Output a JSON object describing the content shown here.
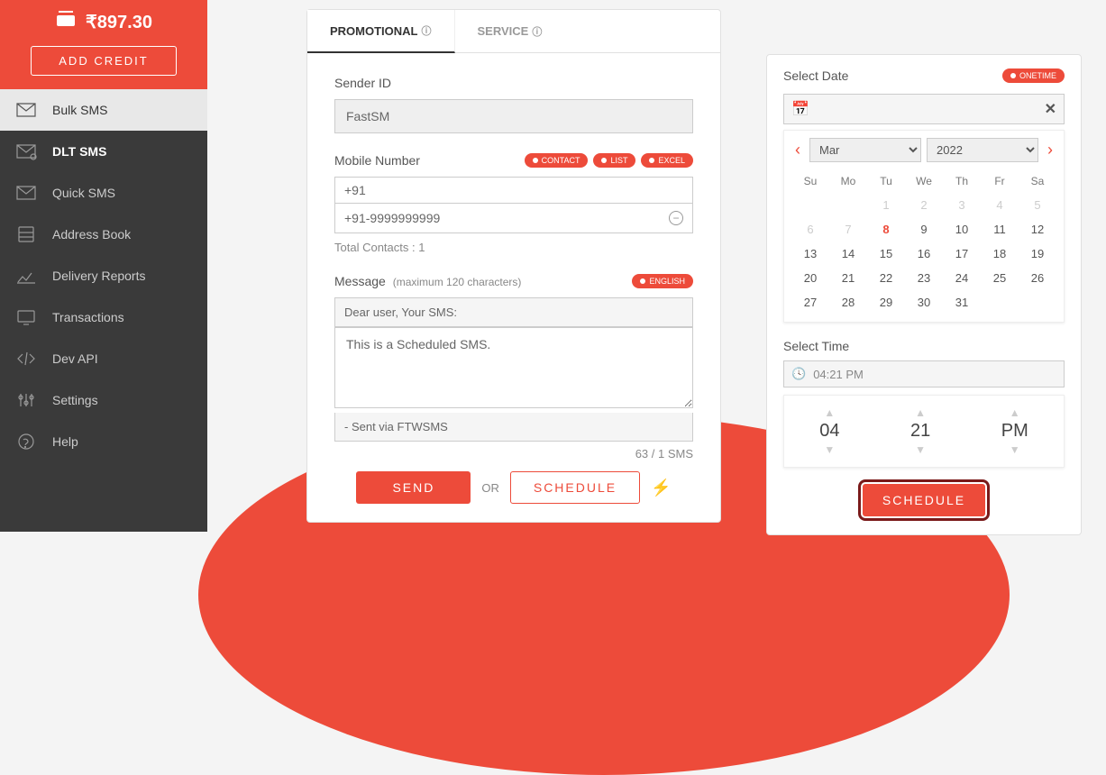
{
  "sidebar": {
    "balance": "₹897.30",
    "add_credit": "ADD CREDIT",
    "items": [
      {
        "label": "Bulk SMS"
      },
      {
        "label": "DLT SMS"
      },
      {
        "label": "Quick SMS"
      },
      {
        "label": "Address Book"
      },
      {
        "label": "Delivery Reports"
      },
      {
        "label": "Transactions"
      },
      {
        "label": "Dev API"
      },
      {
        "label": "Settings"
      },
      {
        "label": "Help"
      }
    ]
  },
  "form": {
    "tabs": {
      "promotional": "PROMOTIONAL",
      "service": "SERVICE"
    },
    "sender_label": "Sender ID",
    "sender_value": "FastSM",
    "mobile_label": "Mobile Number",
    "pills": {
      "contact": "CONTACT",
      "list": "LIST",
      "excel": "EXCEL"
    },
    "prefix": "+91",
    "contact_value": "+91-9999999999",
    "total_contacts": "Total Contacts : 1",
    "message_label": "Message",
    "message_hint": "(maximum 120 characters)",
    "english_pill": "ENGLISH",
    "template_prefix": "Dear user, Your SMS:",
    "message_value": "This is a Scheduled SMS.",
    "template_suffix": "- Sent via FTWSMS",
    "counter": "63 / 1 SMS",
    "send": "SEND",
    "or": "OR",
    "schedule": "SCHEDULE"
  },
  "datepicker": {
    "title": "Select Date",
    "onetime": "ONETIME",
    "month": "Mar",
    "year": "2022",
    "dow": [
      "Su",
      "Mo",
      "Tu",
      "We",
      "Th",
      "Fr",
      "Sa"
    ],
    "weeks": [
      [
        {
          "d": "",
          "m": false
        },
        {
          "d": "",
          "m": false
        },
        {
          "d": "1",
          "m": true
        },
        {
          "d": "2",
          "m": true
        },
        {
          "d": "3",
          "m": true
        },
        {
          "d": "4",
          "m": true
        },
        {
          "d": "5",
          "m": true
        }
      ],
      [
        {
          "d": "6",
          "m": true
        },
        {
          "d": "7",
          "m": true
        },
        {
          "d": "8",
          "m": false,
          "t": true
        },
        {
          "d": "9",
          "m": false
        },
        {
          "d": "10",
          "m": false
        },
        {
          "d": "11",
          "m": false
        },
        {
          "d": "12",
          "m": false
        }
      ],
      [
        {
          "d": "13",
          "m": false
        },
        {
          "d": "14",
          "m": false
        },
        {
          "d": "15",
          "m": false
        },
        {
          "d": "16",
          "m": false
        },
        {
          "d": "17",
          "m": false
        },
        {
          "d": "18",
          "m": false
        },
        {
          "d": "19",
          "m": false
        }
      ],
      [
        {
          "d": "20",
          "m": false
        },
        {
          "d": "21",
          "m": false
        },
        {
          "d": "22",
          "m": false
        },
        {
          "d": "23",
          "m": false
        },
        {
          "d": "24",
          "m": false
        },
        {
          "d": "25",
          "m": false
        },
        {
          "d": "26",
          "m": false
        }
      ],
      [
        {
          "d": "27",
          "m": false
        },
        {
          "d": "28",
          "m": false
        },
        {
          "d": "29",
          "m": false
        },
        {
          "d": "30",
          "m": false
        },
        {
          "d": "31",
          "m": false
        },
        {
          "d": "",
          "m": false
        },
        {
          "d": "",
          "m": false
        }
      ]
    ],
    "time_title": "Select Time",
    "time_value": "04:21 PM",
    "hour": "04",
    "minute": "21",
    "ampm": "PM",
    "schedule": "SCHEDULE"
  }
}
